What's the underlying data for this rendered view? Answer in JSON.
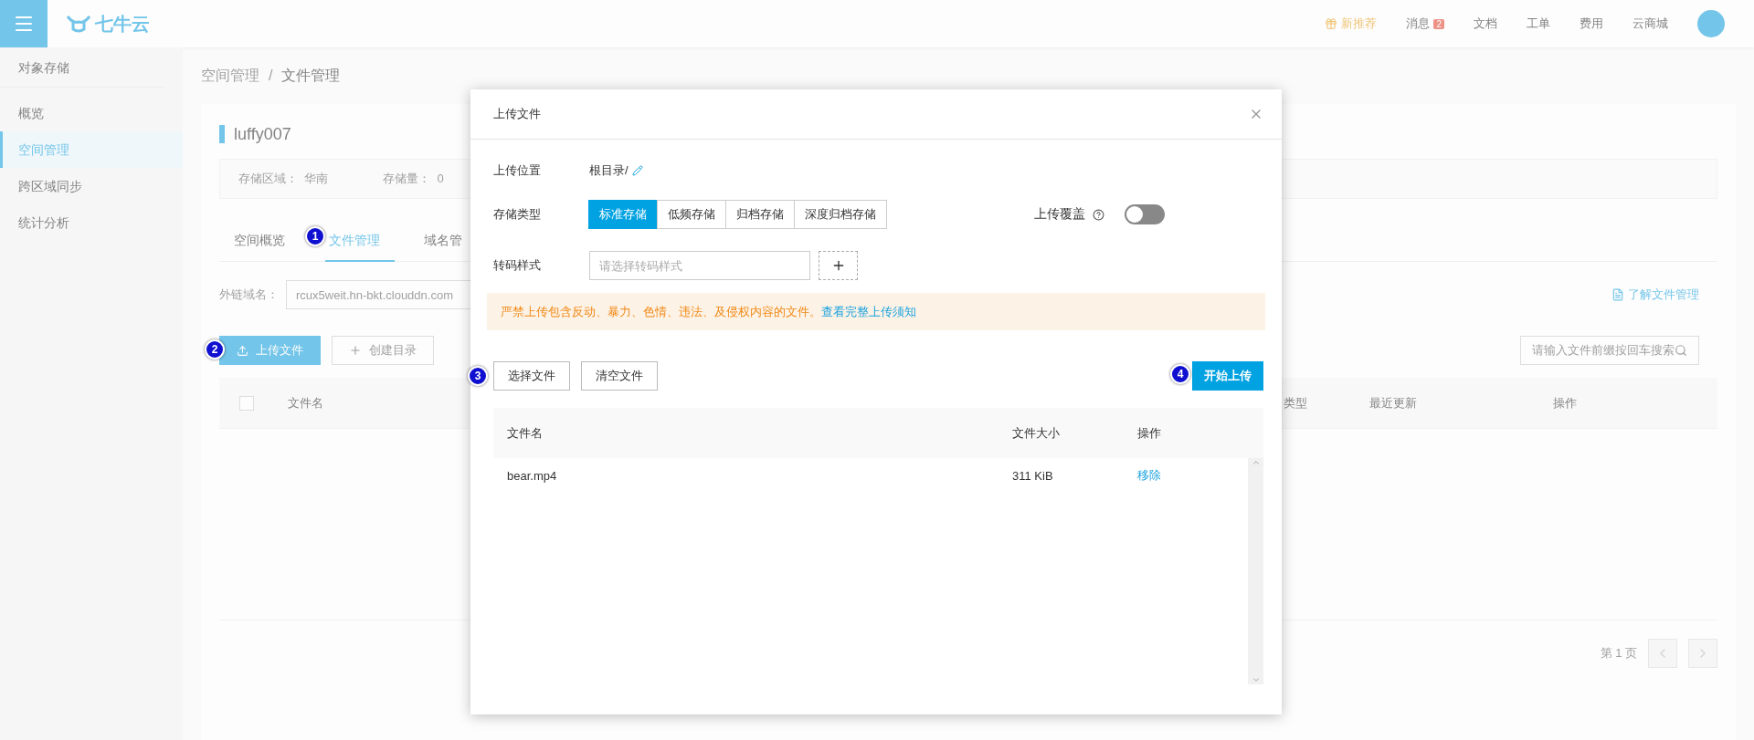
{
  "top_bar": {
    "logo": "七牛云",
    "nav": [
      {
        "label": "新推荐",
        "kind": "gift"
      },
      {
        "label": "消息",
        "kind": "badge",
        "badge": "2"
      },
      {
        "label": "文档",
        "kind": "plain"
      },
      {
        "label": "工单",
        "kind": "plain"
      },
      {
        "label": "费用",
        "kind": "plain"
      },
      {
        "label": "云商城",
        "kind": "plain"
      }
    ]
  },
  "sidebar": {
    "title": "对象存储",
    "items": [
      {
        "label": "概览",
        "selected": false
      },
      {
        "label": "空间管理",
        "selected": true
      },
      {
        "label": "跨区域同步",
        "selected": false
      },
      {
        "label": "统计分析",
        "selected": false
      }
    ]
  },
  "breadcrumb": {
    "items": [
      "空间管理",
      "文件管理"
    ],
    "separator": "/"
  },
  "bucket": {
    "name": "luffy007",
    "info": [
      {
        "label": "存储区域：",
        "value": "华南"
      },
      {
        "label": "存储量：",
        "value": "0"
      }
    ]
  },
  "tabs": [
    {
      "label": "空间概览",
      "selected": false
    },
    {
      "label": "文件管理",
      "selected": true
    },
    {
      "label": "域名管",
      "selected": false
    }
  ],
  "domain": {
    "label": "外链域名：",
    "value": "rcux5weit.hn-bkt.clouddn.com"
  },
  "help_link": "了解文件管理",
  "actions": [
    {
      "label": "上传文件",
      "kind": "primary"
    },
    {
      "label": "创建目录",
      "kind": "default"
    }
  ],
  "search": {
    "placeholder": "请输入文件前缀按回车搜索"
  },
  "file_table": {
    "select_all": {
      "checked": false
    },
    "columns": [
      "文件名",
      "类型",
      "最近更新",
      "操作"
    ]
  },
  "pagination": {
    "page": "第 1 页"
  },
  "dialog": {
    "title": "上传文件",
    "location": {
      "label": "上传位置",
      "value": "根目录/"
    },
    "storage": {
      "label": "存储类型",
      "options": [
        {
          "label": "标准存储",
          "selected": true
        },
        {
          "label": "低频存储",
          "selected": false
        },
        {
          "label": "归档存储",
          "selected": false
        },
        {
          "label": "深度归档存储",
          "selected": false
        }
      ]
    },
    "overwrite": {
      "label": "上传覆盖",
      "on": false
    },
    "transcode": {
      "label": "转码样式",
      "placeholder": "请选择转码样式"
    },
    "warning": {
      "text": "严禁上传包含反动、暴力、色情、违法、及侵权内容的文件。",
      "link": "查看完整上传须知"
    },
    "buttons": [
      {
        "label": "选择文件",
        "kind": "default"
      },
      {
        "label": "清空文件",
        "kind": "default"
      },
      {
        "label": "开始上传",
        "kind": "primary"
      }
    ],
    "table": {
      "columns": [
        "文件名",
        "文件大小",
        "操作"
      ],
      "rows": [
        {
          "name": "bear.mp4",
          "size": "311 KiB",
          "action": "移除"
        }
      ]
    }
  },
  "markers": [
    "1",
    "2",
    "3",
    "4"
  ]
}
